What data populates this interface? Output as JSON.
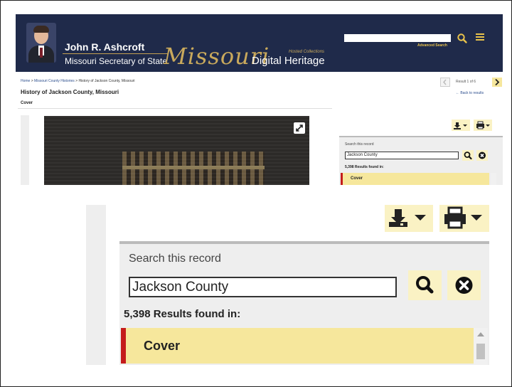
{
  "banner": {
    "official_name": "John R. Ashcroft",
    "official_title": "Missouri Secretary of State",
    "brand_script": "Missouri",
    "brand_suffix": "Digital Heritage",
    "brand_hosted": "Hosted Collections",
    "advanced_search": "Advanced Search",
    "site_search_value": "",
    "colors": {
      "banner_bg": "#1f2a4a",
      "gold": "#c9a95c",
      "accent_yellow": "#e8c24b"
    },
    "icons": {
      "search": "search-icon",
      "menu": "hamburger-icon"
    }
  },
  "breadcrumb": {
    "home": "Home",
    "sep1": " > ",
    "collection": "Missouri County Histories",
    "sep2": " > ",
    "current": "History of Jackson County, Missouri"
  },
  "document": {
    "title": "History of Jackson County, Missouri",
    "page_label": "Cover"
  },
  "pager": {
    "result_count": "Result 1 of 6",
    "back_to_results": "← Back to results",
    "icons": {
      "prev": "chevron-left-icon",
      "next": "chevron-right-icon"
    }
  },
  "toolbar": {
    "icons": {
      "download": "download-icon",
      "print": "print-icon",
      "expand": "expand-icon"
    }
  },
  "record_search": {
    "label": "Search this record",
    "query": "Jackson County",
    "results_summary": "5,398 Results found in:",
    "results": [
      {
        "label": "Cover",
        "selected": true
      }
    ],
    "icons": {
      "search": "search-icon",
      "clear": "clear-circle-icon"
    },
    "colors": {
      "button_bg": "#faf2c4",
      "selected_bg": "#f6e79c",
      "selected_marker": "#c41c1c"
    }
  }
}
